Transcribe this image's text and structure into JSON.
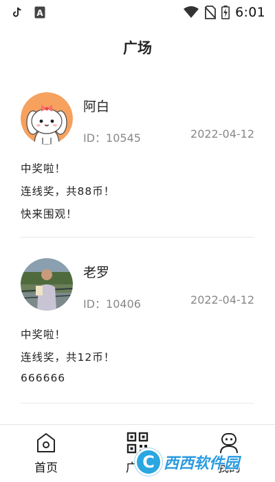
{
  "status_bar": {
    "time": "6:01",
    "left_icons": [
      "tiktok-icon",
      "translate-a-icon"
    ],
    "right_icons": [
      "wifi-icon",
      "no-sim-icon",
      "battery-charging-icon"
    ]
  },
  "header": {
    "title": "广场"
  },
  "posts": [
    {
      "username": "阿白",
      "user_id": "ID：10545",
      "date": "2022-04-12",
      "lines": [
        "中奖啦！",
        "连线奖，共88币！",
        "快来围观！"
      ],
      "avatar": "cartoon-bunny-avatar"
    },
    {
      "username": "老罗",
      "user_id": "ID：10406",
      "date": "2022-04-12",
      "lines": [
        "中奖啦！",
        "连线奖，共12币！",
        "666666"
      ],
      "avatar": "photo-person-avatar"
    }
  ],
  "bottom_nav": {
    "items": [
      {
        "label": "首页",
        "icon": "home-icon"
      },
      {
        "label": "广场",
        "icon": "qr-grid-icon"
      },
      {
        "label": "我的",
        "icon": "user-robot-icon"
      }
    ]
  },
  "watermark": {
    "text": "西西软件园"
  },
  "colors": {
    "accent_orange": "#f6a15e",
    "text_primary": "#222222",
    "text_secondary": "#888888",
    "divider": "#e8e8e8"
  }
}
